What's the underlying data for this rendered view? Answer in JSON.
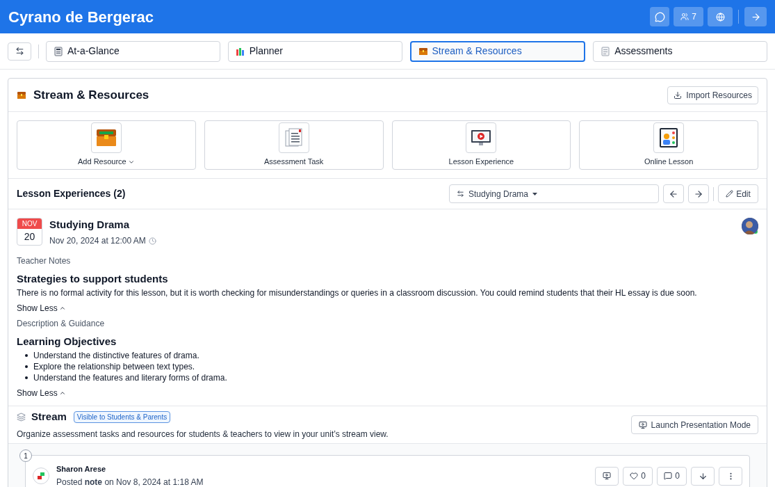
{
  "header": {
    "title": "Cyrano de Bergerac",
    "members_count": "7"
  },
  "tabs": [
    {
      "label": "At-a-Glance",
      "kind": "glance",
      "selected": false
    },
    {
      "label": "Planner",
      "kind": "planner",
      "selected": false
    },
    {
      "label": "Stream & Resources",
      "kind": "chest",
      "selected": true
    },
    {
      "label": "Assessments",
      "kind": "notes",
      "selected": false
    }
  ],
  "section": {
    "title": "Stream & Resources",
    "import_button": "Import Resources"
  },
  "resource_tiles": [
    {
      "label": "Add Resource",
      "kind": "chest",
      "has_menu": true
    },
    {
      "label": "Assessment Task",
      "kind": "document",
      "has_menu": false
    },
    {
      "label": "Lesson Experience",
      "kind": "video",
      "has_menu": false
    },
    {
      "label": "Online Lesson",
      "kind": "online",
      "has_menu": false
    }
  ],
  "lesson_experiences": {
    "title": "Lesson Experiences (2)",
    "selector": "Studying Drama",
    "edit_button": "Edit"
  },
  "lesson": {
    "month": "NOV",
    "day": "20",
    "title": "Studying Drama",
    "datetime": "Nov 20, 2024 at 12:00 AM",
    "author_online": true,
    "sections": [
      {
        "label": "Teacher Notes",
        "heading": "Strategies to support students",
        "paragraph": "There is no formal activity for this lesson, but it is worth checking for misunderstandings or queries in a classroom discussion. You could remind students that their HL essay is due soon.",
        "toggle": "Show Less"
      },
      {
        "label": "Description & Guidance",
        "heading": "Learning Objectives",
        "bullets": [
          "Understand the distinctive features of drama.",
          "Explore the relationship between text types.",
          "Understand the features and literary forms of drama."
        ],
        "toggle": "Show Less"
      }
    ]
  },
  "stream": {
    "title": "Stream",
    "badge": "Visible to Students & Parents",
    "description": "Organize assessment tasks and resources for students & teachers to view in your unit’s stream view.",
    "launch_button": "Launch Presentation Mode"
  },
  "posts": [
    {
      "number": "1",
      "author": "Sharon Arese",
      "posted": "Posted **note** on Nov 8, 2024 at 1:18 AM",
      "likes": "0",
      "comments": "0"
    }
  ]
}
